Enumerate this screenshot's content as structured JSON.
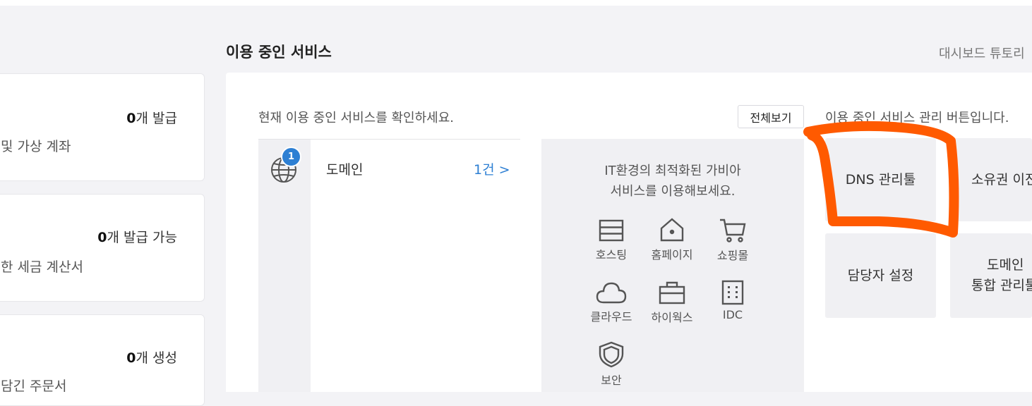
{
  "left_cards": [
    {
      "count_num": "0",
      "count_text": "개 발급",
      "desc": "및 가상 계좌"
    },
    {
      "count_num": "0",
      "count_text": "개 발급 가능",
      "desc": "한 세금 계산서"
    },
    {
      "count_num": "0",
      "count_text": "개 생성",
      "desc": "담긴 주문서"
    }
  ],
  "section": {
    "title": "이용 중인 서비스",
    "dashboard_link": "대시보드 튜토리",
    "subtitle": "현재 이용 중인 서비스를 확인하세요.",
    "view_all": "전체보기",
    "mgmt_caption": "이용 중인 서비스 관리 버튼입니다."
  },
  "services": [
    {
      "name": "도메인",
      "count": "1건 >",
      "badge": "1",
      "icon": "globe-icon"
    }
  ],
  "promo": {
    "line1": "IT환경의 최적화된 가비아",
    "line2": "서비스를 이용해보세요.",
    "items": [
      {
        "label": "호스팅",
        "icon": "server-icon"
      },
      {
        "label": "홈페이지",
        "icon": "home-icon"
      },
      {
        "label": "쇼핑몰",
        "icon": "cart-icon"
      },
      {
        "label": "클라우드",
        "icon": "cloud-icon"
      },
      {
        "label": "하이웍스",
        "icon": "briefcase-icon"
      },
      {
        "label": "IDC",
        "icon": "building-icon"
      },
      {
        "label": "보안",
        "icon": "shield-icon"
      }
    ]
  },
  "mgmt_buttons": [
    {
      "line1": "DNS 관리툴",
      "line2": ""
    },
    {
      "line1": "소유권 이전",
      "line2": ""
    },
    {
      "line1": "담당자 설정",
      "line2": ""
    },
    {
      "line1": "도메인",
      "line2": "통합 관리툴"
    }
  ],
  "colors": {
    "accent": "#2d7fd3",
    "annotation": "#ff5a00",
    "panel_bg": "#f0f0f3"
  }
}
